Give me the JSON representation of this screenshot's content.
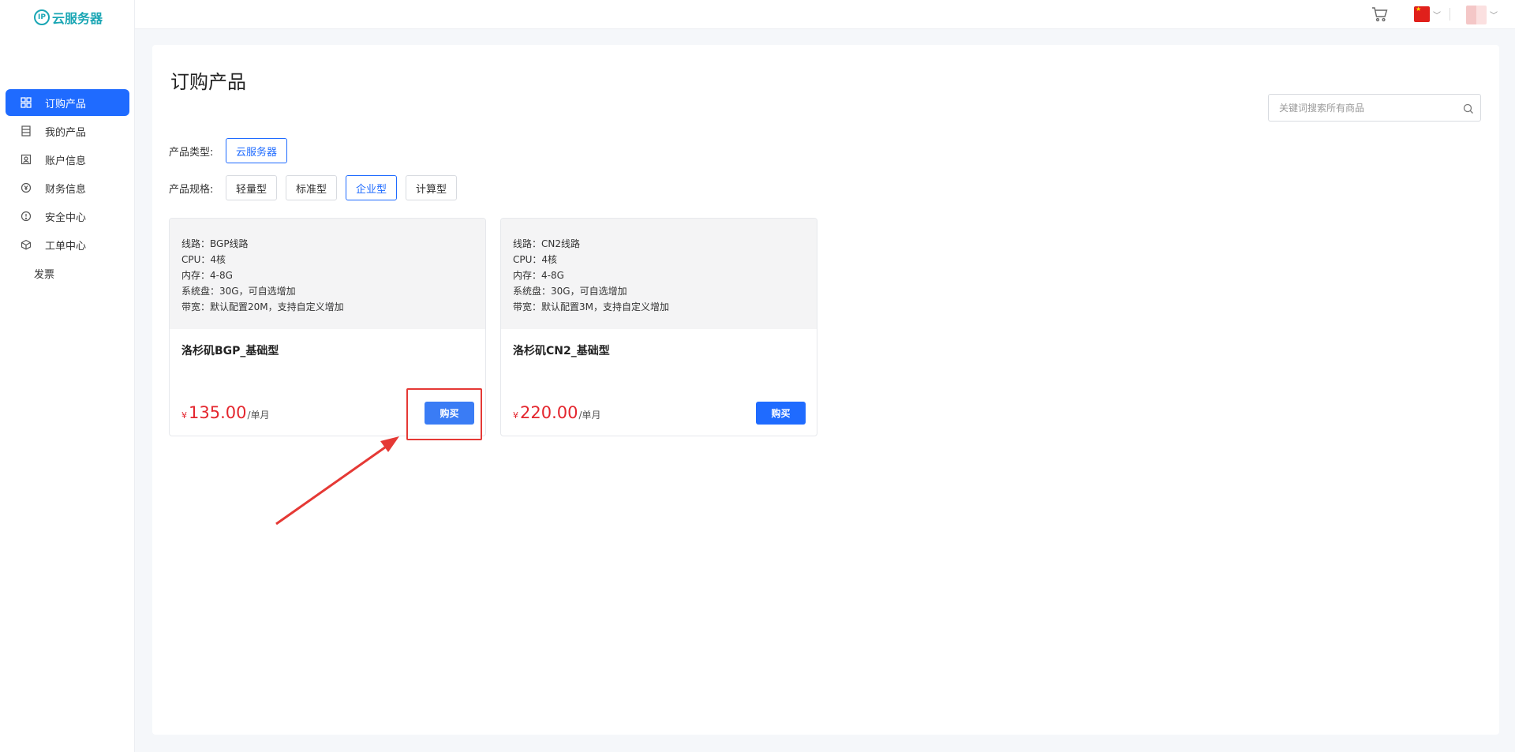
{
  "app": {
    "logo_text": "云服务器",
    "logo_badge": "IP"
  },
  "sidebar": {
    "items": [
      {
        "label": "订购产品",
        "icon": "grid-icon",
        "active": true
      },
      {
        "label": "我的产品",
        "icon": "server-icon",
        "active": false
      },
      {
        "label": "账户信息",
        "icon": "id-card-icon",
        "active": false
      },
      {
        "label": "财务信息",
        "icon": "yuan-circle-icon",
        "active": false
      },
      {
        "label": "安全中心",
        "icon": "alert-circle-icon",
        "active": false
      },
      {
        "label": "工单中心",
        "icon": "cube-icon",
        "active": false
      },
      {
        "label": "发票",
        "icon": "",
        "active": false
      }
    ]
  },
  "topbar": {
    "icons": [
      "cart-icon",
      "china-flag-icon",
      "chevron-down-icon",
      "avatar"
    ]
  },
  "main": {
    "title": "订购产品",
    "search": {
      "placeholder": "关键词搜索所有商品",
      "value": ""
    },
    "product_type": {
      "label": "产品类型:",
      "options": [
        "云服务器"
      ],
      "selected": "云服务器"
    },
    "product_spec": {
      "label": "产品规格:",
      "options": [
        "轻量型",
        "标准型",
        "企业型",
        "计算型"
      ],
      "selected": "企业型"
    },
    "products": [
      {
        "specs": [
          "线路：BGP线路",
          "CPU：4核",
          "内存：4-8G",
          "系统盘：30G，可自选增加",
          "带宽：默认配置20M，支持自定义增加"
        ],
        "name": "洛杉矶BGP_基础型",
        "currency": "¥",
        "price": "135.00",
        "unit": "/单月",
        "buy_label": "购买"
      },
      {
        "specs": [
          "线路：CN2线路",
          "CPU：4核",
          "内存：4-8G",
          "系统盘：30G，可自选增加",
          "带宽：默认配置3M，支持自定义增加"
        ],
        "name": "洛杉矶CN2_基础型",
        "currency": "¥",
        "price": "220.00",
        "unit": "/单月",
        "buy_label": "购买"
      }
    ]
  },
  "colors": {
    "accent": "#1f6bff",
    "price": "#e4262e",
    "annotation": "#e53935"
  }
}
